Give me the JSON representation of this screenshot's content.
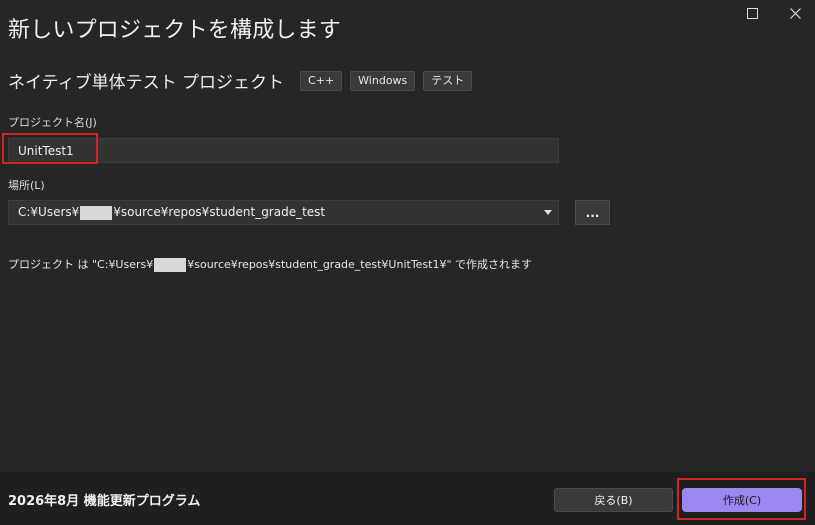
{
  "window": {
    "title": "新しいプロジェクトを構成します",
    "controls": {
      "maximize": "maximize",
      "close": "close"
    }
  },
  "project_type": {
    "name": "ネイティブ単体テスト プロジェクト",
    "tags": [
      "C++",
      "Windows",
      "テスト"
    ]
  },
  "project_name": {
    "label": "プロジェクト名(J)",
    "value": "UnitTest1"
  },
  "location": {
    "label": "場所(L)",
    "value_prefix": "C:¥Users¥",
    "value_suffix": "¥source¥repos¥student_grade_test",
    "browse_label": "..."
  },
  "path_note": {
    "prefix": "プロジェクト は \"C:¥Users¥",
    "suffix": "¥source¥repos¥student_grade_test¥UnitTest1¥\" で作成されます"
  },
  "footer": {
    "version": "2026年8月 機能更新プログラム",
    "back_label": "戻る(B)",
    "create_label": "作成(C)"
  },
  "colors": {
    "background": "#262626",
    "accent": "#9d86f0",
    "highlight": "#d42525"
  }
}
